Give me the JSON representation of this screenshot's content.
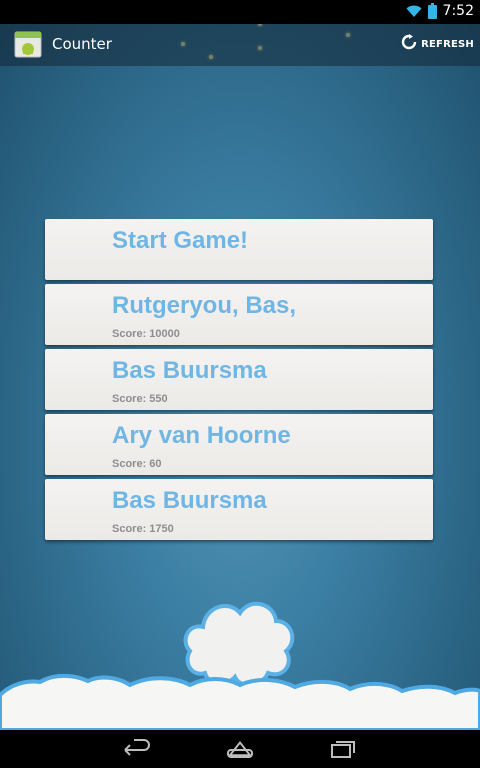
{
  "status_bar": {
    "time": "7:52",
    "icons": [
      "wifi-icon",
      "battery-icon"
    ]
  },
  "action_bar": {
    "title": "Counter",
    "app_icon": "android-app-icon",
    "refresh_label": "REFRESH",
    "refresh_icon": "refresh-icon"
  },
  "cards": [
    {
      "title": "Start Game!",
      "score": ""
    },
    {
      "title": "Rutgeryou, Bas,",
      "score": "Score: 10000"
    },
    {
      "title": "Bas Buursma",
      "score": "Score: 550"
    },
    {
      "title": "Ary van Hoorne",
      "score": "Score: 60"
    },
    {
      "title": "Bas Buursma",
      "score": "Score: 1750"
    }
  ],
  "nav_bar": {
    "icons": [
      "back-icon",
      "home-icon",
      "recent-apps-icon"
    ]
  },
  "colors": {
    "card_title": "#6fb6e4",
    "card_score": "#8e8e8e",
    "background": "#3b7ea3",
    "cloud_outline": "#5bb0e6"
  }
}
